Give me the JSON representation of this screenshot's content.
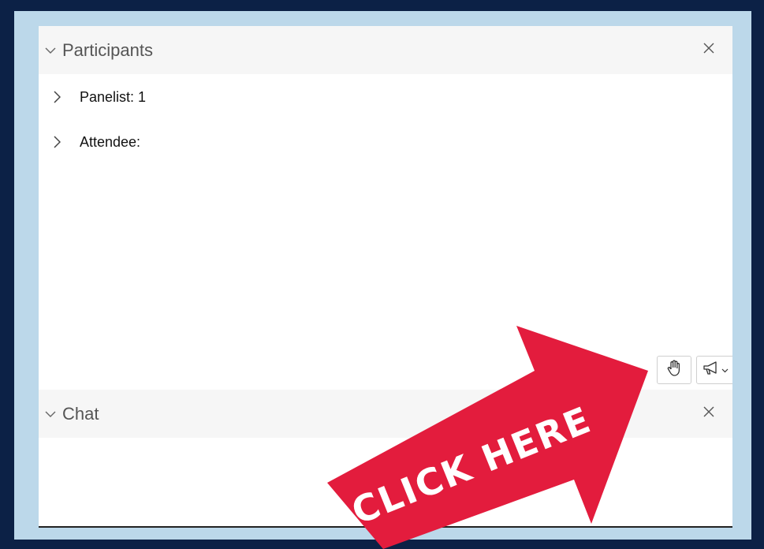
{
  "participants_panel": {
    "title": "Participants",
    "groups": [
      {
        "label": "Panelist: 1"
      },
      {
        "label": "Attendee:"
      }
    ]
  },
  "toolbar": {
    "raise_hand_icon": "hand-icon",
    "reactions_icon": "megaphone-icon"
  },
  "chat_panel": {
    "title": "Chat"
  },
  "callout": {
    "text": "CLICK HERE",
    "color": "#e31c3d"
  },
  "colors": {
    "background": "#0c2146",
    "frame": "#bcd8ea",
    "header": "#f6f6f6"
  }
}
